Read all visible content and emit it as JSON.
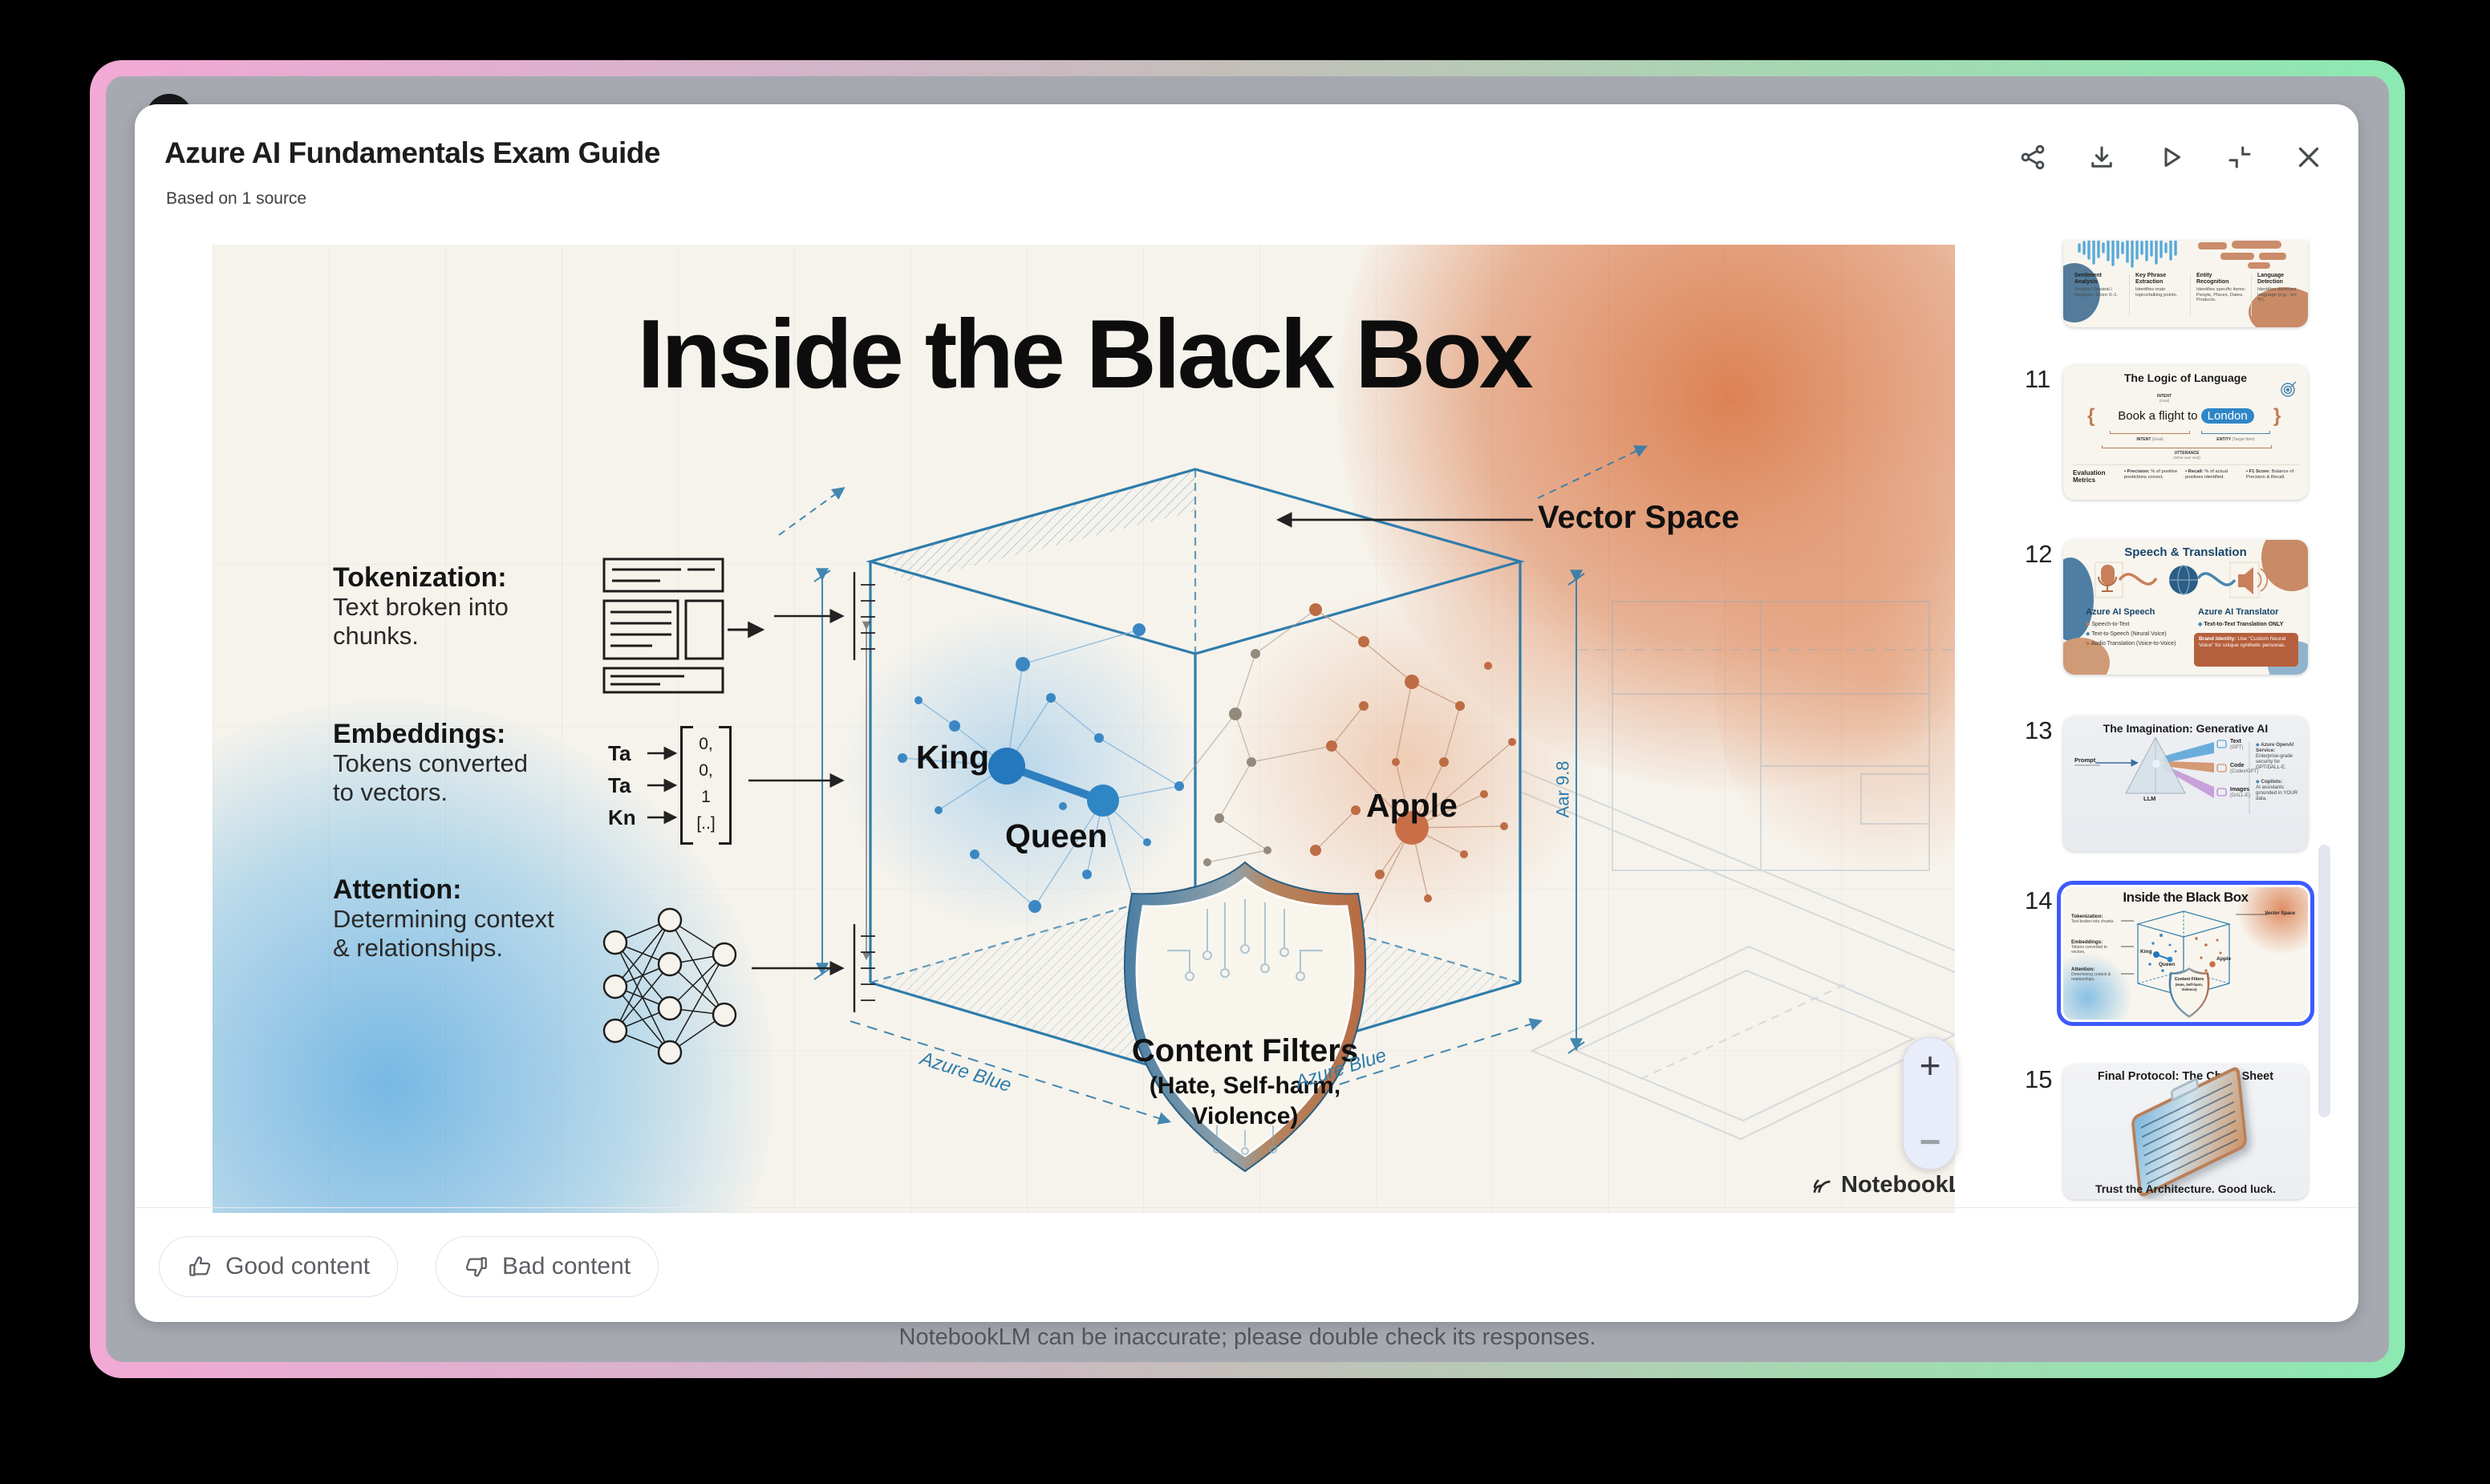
{
  "colors": {
    "selection_accent": "#3D5AFE",
    "entity_pill_blue": "#2E86C7",
    "window_gradient_start": "#F2A9D6",
    "window_gradient_end": "#8CE9B1",
    "slide_blueprint_blue": "#2F7CAB"
  },
  "header": {
    "title": "Azure AI Fundamentals Exam Guide",
    "subtitle": "Based on 1 source",
    "icons": [
      "share",
      "download",
      "play",
      "collapse",
      "close"
    ]
  },
  "slide": {
    "title": "Inside the Black Box",
    "vector_space": "Vector Space",
    "concepts": [
      {
        "heading": "Tokenization:",
        "line1": "Text broken into",
        "line2": "chunks."
      },
      {
        "heading": "Embeddings:",
        "line1": "Tokens converted",
        "line2": "to vectors."
      },
      {
        "heading": "Attention:",
        "line1": "Determining context",
        "line2": "& relationships."
      }
    ],
    "tokens": [
      "Ta",
      "Ta",
      "Kn"
    ],
    "vector_values": [
      "0,",
      "0,",
      "1",
      "[..]"
    ],
    "point_labels": {
      "king": "King",
      "queen": "Queen",
      "apple": "Apple"
    },
    "shield": {
      "title": "Content Filters",
      "line2": "(Hate, Self-harm,",
      "line3": "Violence)"
    },
    "edge_label_left": "Azure Blue",
    "edge_label_right": "Azure Blue",
    "dim_label": "Aar 9.8",
    "watermark": "NotebookLM"
  },
  "zoom_controls": {
    "zoom_in": "+",
    "zoom_out": "−"
  },
  "sidebar": {
    "items": [
      {
        "number": "",
        "columns": [
          {
            "h1": "Sentiment",
            "h2": "Analysis",
            "body": "Positive / Neutral / Negative. Score 0–1."
          },
          {
            "h1": "Key Phrase",
            "h2": "Extraction",
            "body": "Identifies main topics/talking points."
          },
          {
            "h1": "Entity",
            "h2": "Recognition",
            "body": "Identifies specific items: People, Places, Dates, Products."
          },
          {
            "h1": "Language",
            "h2": "Detection",
            "body": "Identifies dominant language (e.g., 'en', 'fr')."
          }
        ]
      },
      {
        "number": "11",
        "title": "The Logic of Language",
        "sentence": "Book a flight to",
        "entity_pill": "London",
        "intent_top": "INTENT",
        "intent_top_sub": "(Goal)",
        "intent_bottom": "INTENT",
        "intent_bottom_sub": "(Goal)",
        "entity_label": "ENTITY",
        "entity_label_sub": "(Target Item)",
        "utterance": "UTTERANCE",
        "utterance_sub": "(What user said)",
        "metrics_heading": "Evaluation Metrics",
        "metric1_lead": "Precision:",
        "metric1": "% of positive predictions correct.",
        "metric2_lead": "Recall:",
        "metric2": "% of actual positives identified.",
        "metric3_lead": "F1 Score:",
        "metric3": "Balance of Precision & Recall."
      },
      {
        "number": "12",
        "title": "Speech & Translation",
        "speech_heading": "Azure AI Speech",
        "speech1": "Speech-to-Text",
        "speech2": "Text-to-Speech (Neural Voice)",
        "speech3": "Audio Translation (Voice-to-Voice)",
        "translator_heading": "Azure AI Translator",
        "translator1": "Text-to-Text Translation ONLY",
        "callout_lead": "Brand Identity:",
        "callout": "Use \"Custom Neural Voice\" for unique synthetic personas."
      },
      {
        "number": "13",
        "title": "The Imagination: Generative AI",
        "prompt": "Prompt",
        "llm": "LLM",
        "out1": "Text",
        "out1_sub": "(GPT)",
        "out2": "Code",
        "out2_sub": "(Codex/GPT)",
        "out3": "Images",
        "out3_sub": "(DALL-E)",
        "note1_lead": "Azure OpenAI Service:",
        "note1": "Enterprise-grade security for GPT/DALL-E.",
        "note2_lead": "Copilots:",
        "note2": "AI assistants grounded in YOUR data."
      },
      {
        "number": "14",
        "title": "Inside the Black Box",
        "vector_space": "Vector Space",
        "c1_heading": "Tokenization:",
        "c1": "Text broken into chunks.",
        "c2_heading": "Embeddings:",
        "c2": "Tokens converted to vectors.",
        "c3_heading": "Attention:",
        "c3": "Determining context & relationships.",
        "king": "King",
        "queen": "Queen",
        "apple": "Apple",
        "shield1": "Content Filters",
        "shield2": "(Hate, Self-harm,",
        "shield3": "Violence)"
      },
      {
        "number": "15",
        "title": "Final Protocol: The Cheat Sheet",
        "footer": "Trust the Architecture. Good luck."
      }
    ]
  },
  "feedback": {
    "good": "Good content",
    "bad": "Bad content"
  },
  "disclaimer": "NotebookLM can be inaccurate; please double check its responses."
}
